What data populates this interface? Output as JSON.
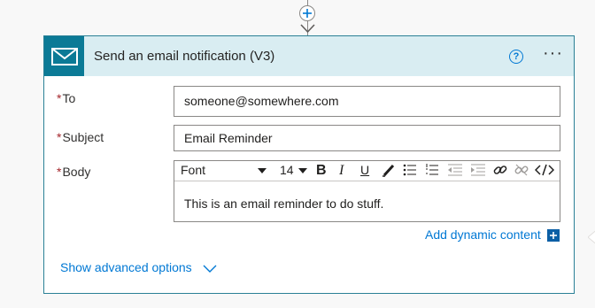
{
  "action_card": {
    "title": "Send an email notification (V3)",
    "help_symbol": "?",
    "more_symbol": "···",
    "icon": "envelope-icon"
  },
  "fields": {
    "to": {
      "required_mark": "*",
      "label": "To",
      "value": "someone@somewhere.com"
    },
    "subject": {
      "required_mark": "*",
      "label": "Subject",
      "value": "Email Reminder"
    },
    "body": {
      "required_mark": "*",
      "label": "Body",
      "value": "This is an email reminder to do stuff."
    }
  },
  "toolbar": {
    "font": "Font",
    "size": "14",
    "bold": "B",
    "italic": "I",
    "underline": "U"
  },
  "links": {
    "add_dynamic_content": "Add dynamic content",
    "show_advanced_options": "Show advanced options"
  },
  "colors": {
    "header_bg": "#d9edf2",
    "icon_bg": "#0b7a96",
    "border": "#2a8096",
    "link": "#0078d4",
    "required": "#a4262c"
  }
}
